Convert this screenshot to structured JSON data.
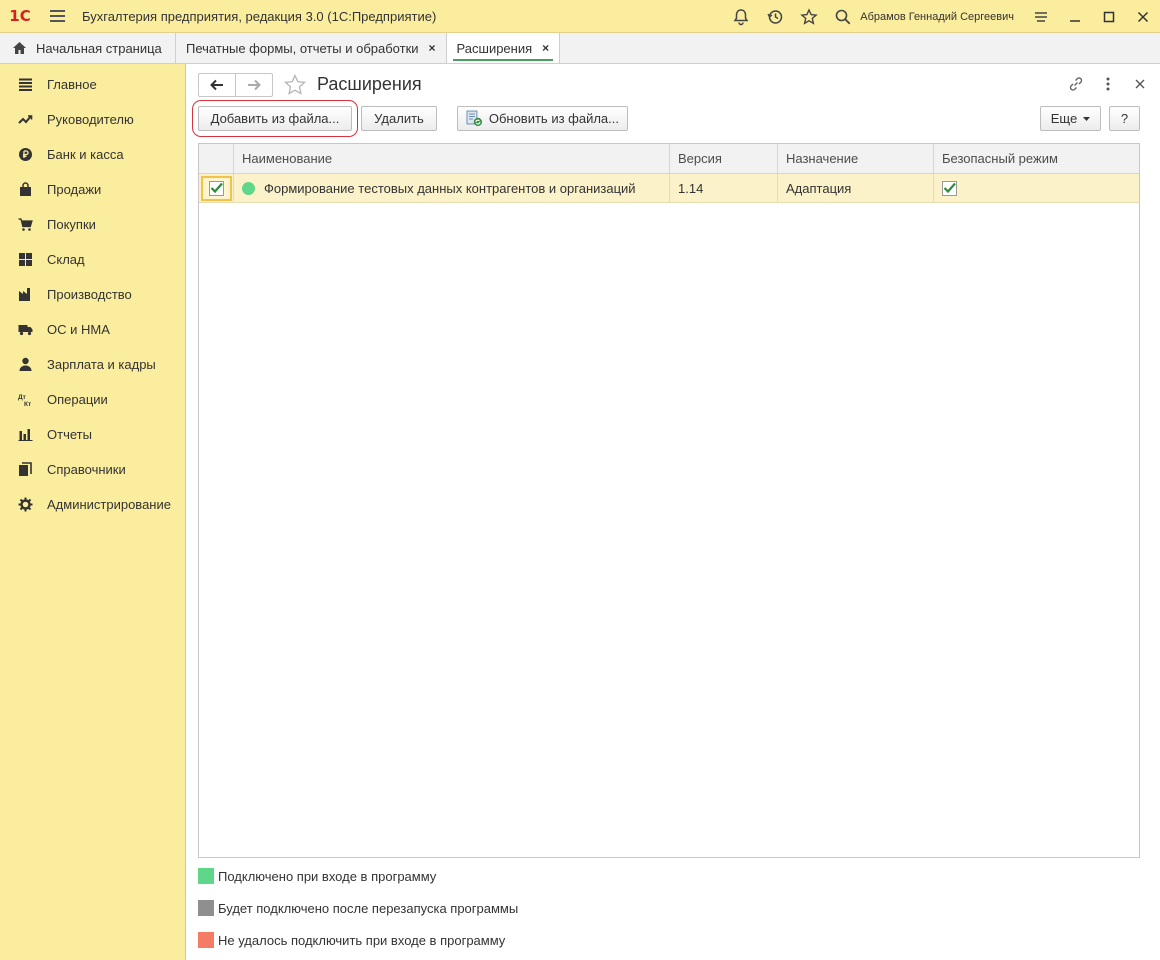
{
  "app": {
    "logo": "1С",
    "title": "Бухгалтерия предприятия, редакция 3.0  (1С:Предприятие)",
    "user": "Абрамов Геннадий Сергеевич"
  },
  "tabs": {
    "home": "Начальная страница",
    "items": [
      {
        "label": "Печатные формы, отчеты и обработки",
        "close": "×"
      },
      {
        "label": "Расширения",
        "close": "×"
      }
    ]
  },
  "sidebar": {
    "items": [
      {
        "label": "Главное",
        "icon": "menu-lines-icon"
      },
      {
        "label": "Руководителю",
        "icon": "trend-icon"
      },
      {
        "label": "Банк и касса",
        "icon": "ruble-coin-icon"
      },
      {
        "label": "Продажи",
        "icon": "shopping-bag-icon"
      },
      {
        "label": "Покупки",
        "icon": "cart-icon"
      },
      {
        "label": "Склад",
        "icon": "boxes-icon"
      },
      {
        "label": "Производство",
        "icon": "factory-icon"
      },
      {
        "label": "ОС и НМА",
        "icon": "truck-icon"
      },
      {
        "label": "Зарплата и кадры",
        "icon": "person-icon"
      },
      {
        "label": "Операции",
        "icon": "dt-kt-icon"
      },
      {
        "label": "Отчеты",
        "icon": "bar-chart-icon"
      },
      {
        "label": "Справочники",
        "icon": "books-icon"
      },
      {
        "label": "Администрирование",
        "icon": "gear-icon"
      }
    ]
  },
  "page": {
    "title": "Расширения"
  },
  "toolbar": {
    "add_label": "Добавить из файла...",
    "delete_label": "Удалить",
    "update_label": "Обновить из файла...",
    "more_label": "Еще",
    "help_label": "?"
  },
  "table": {
    "columns": [
      "Наименование",
      "Версия",
      "Назначение",
      "Безопасный режим"
    ],
    "rows": [
      {
        "active": true,
        "status_color": "#5fd68a",
        "name": "Формирование тестовых данных контрагентов и организаций",
        "version": "1.14",
        "purpose": "Адаптация",
        "safe_mode": true
      }
    ]
  },
  "legend": [
    {
      "label": "Подключено при входе в программу",
      "color": "#5fd68a"
    },
    {
      "label": "Будет подключено после перезапуска программы",
      "color": "#8f8f8f"
    },
    {
      "label": "Не удалось подключить при входе в программу",
      "color": "#f57c64"
    }
  ],
  "colors": {
    "accent_yellow": "#fbed9e",
    "active_tab_underline": "#4b9e5f",
    "highlight_ring": "#d9323c",
    "check_green": "#2e8b3a"
  }
}
